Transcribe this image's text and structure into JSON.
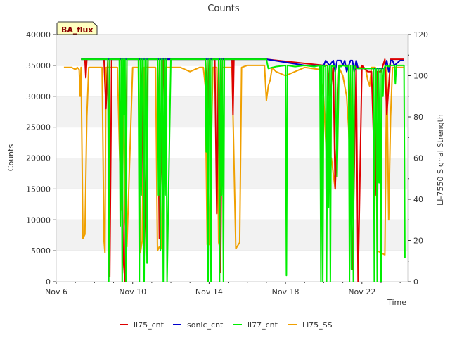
{
  "chart_data": {
    "type": "line",
    "title": "Counts",
    "site_badge": "BA_flux",
    "xlabel": "Time",
    "ylabel_left": "Counts",
    "ylabel_right": "LI-7550 Signal Strength",
    "x_range": [
      6,
      24.4
    ],
    "x_ticks": [
      6,
      10,
      14,
      18,
      22
    ],
    "x_tick_labels": [
      "Nov 6",
      "Nov 10",
      "Nov 14",
      "Nov 18",
      "Nov 22"
    ],
    "y_left_range": [
      0,
      40000
    ],
    "y_left_ticks": [
      0,
      5000,
      10000,
      15000,
      20000,
      25000,
      30000,
      35000,
      40000
    ],
    "y_right_range": [
      0,
      120
    ],
    "y_right_ticks": [
      0,
      20,
      40,
      60,
      80,
      100,
      120
    ],
    "grid": "horizontal bands",
    "legend_position": "bottom",
    "series": [
      {
        "name": "li75_cnt",
        "axis": "left",
        "color": "#dd0000",
        "x": [
          7.3,
          7.5,
          7.55,
          7.6,
          7.65,
          8.5,
          8.6,
          8.7,
          8.8,
          8.9,
          9.0,
          9.4,
          9.5,
          9.6,
          9.7,
          10.4,
          10.5,
          10.6,
          10.7,
          10.8,
          11.3,
          11.4,
          11.5,
          11.6,
          11.7,
          13.8,
          13.9,
          14.0,
          14.1,
          14.3,
          14.4,
          14.5,
          14.6,
          14.7,
          15.2,
          15.25,
          15.3,
          15.4,
          17.0,
          20.0,
          20.2,
          20.3,
          20.5,
          20.6,
          20.8,
          21.0,
          21.3,
          21.5,
          21.7,
          21.8,
          22.0,
          22.3,
          22.5,
          22.7,
          22.8,
          22.9,
          23.0,
          23.2,
          23.3,
          23.5,
          23.6,
          23.7,
          23.9,
          24.0,
          24.1,
          24.2
        ],
        "y": [
          36000,
          36000,
          33000,
          36000,
          36000,
          36000,
          28000,
          36000,
          800,
          36000,
          36000,
          36000,
          4000,
          0,
          36000,
          36000,
          28000,
          4000,
          17000,
          36000,
          36000,
          7000,
          20000,
          36000,
          36000,
          36000,
          25000,
          36000,
          36000,
          36000,
          11000,
          36000,
          1500,
          36000,
          36000,
          27000,
          36000,
          36000,
          36000,
          35000,
          35000,
          29000,
          35000,
          15000,
          35000,
          35000,
          35000,
          2000,
          35000,
          0,
          35000,
          34000,
          34000,
          14000,
          34000,
          34000,
          34000,
          36000,
          27000,
          36000,
          36000,
          36000,
          36000,
          36000,
          36000,
          36000
        ]
      },
      {
        "name": "sonic_cnt",
        "axis": "left",
        "color": "#0000cc",
        "x": [
          7.3,
          17.0,
          19.0,
          20.0,
          20.1,
          20.3,
          20.5,
          20.6,
          20.7,
          20.9,
          21.0,
          21.1,
          21.2,
          21.4,
          21.5,
          21.6,
          21.7,
          21.8,
          21.9,
          22.0,
          22.5,
          23.2,
          23.3,
          23.4,
          23.5,
          23.6,
          23.7,
          24.0,
          24.2
        ],
        "y": [
          36000,
          36000,
          35000,
          35000,
          35800,
          35000,
          35800,
          34000,
          35800,
          35800,
          35000,
          35800,
          34000,
          35800,
          35800,
          34000,
          35800,
          34500,
          34500,
          34500,
          34500,
          34500,
          35800,
          34000,
          35800,
          35800,
          35000,
          35800,
          35800
        ]
      },
      {
        "name": "li77_cnt",
        "axis": "left",
        "color": "#00ee00",
        "x": [
          7.3,
          8.7,
          8.75,
          8.8,
          8.9,
          9.2,
          9.3,
          9.35,
          9.4,
          9.45,
          9.5,
          9.55,
          9.6,
          9.65,
          9.7,
          10.0,
          10.2,
          10.3,
          10.35,
          10.4,
          10.45,
          10.5,
          10.55,
          10.6,
          10.65,
          10.7,
          10.75,
          10.8,
          11.0,
          11.3,
          11.35,
          11.4,
          11.45,
          11.5,
          11.55,
          11.6,
          11.65,
          11.7,
          11.75,
          11.8,
          12.0,
          13.8,
          13.85,
          13.9,
          13.95,
          14.0,
          14.05,
          14.1,
          14.15,
          14.2,
          14.5,
          14.55,
          14.6,
          14.65,
          14.7,
          14.75,
          14.8,
          14.9,
          17.0,
          17.1,
          17.5,
          18.0,
          18.05,
          18.1,
          18.5,
          19.0,
          19.5,
          19.8,
          19.85,
          19.9,
          19.95,
          20.0,
          20.1,
          20.15,
          20.2,
          20.25,
          20.3,
          20.35,
          20.4,
          20.5,
          20.6,
          20.7,
          20.8,
          20.9,
          21.0,
          21.2,
          21.3,
          21.35,
          21.4,
          21.45,
          21.5,
          21.55,
          21.6,
          21.7,
          21.8,
          22.0,
          22.5,
          22.6,
          22.65,
          22.7,
          22.75,
          22.8,
          22.85,
          22.9,
          22.95,
          23.0,
          23.05,
          23.1,
          23.15,
          23.2,
          23.3,
          23.4,
          23.5,
          23.6,
          23.7,
          23.75,
          23.8,
          23.9,
          24.0,
          24.2,
          24.25
        ],
        "y": [
          36000,
          36000,
          0,
          36000,
          36000,
          36000,
          36000,
          9000,
          36000,
          0,
          36000,
          27000,
          36000,
          0,
          36000,
          36000,
          36000,
          36000,
          0,
          36000,
          14000,
          36000,
          36000,
          0,
          36000,
          36000,
          3000,
          36000,
          36000,
          36000,
          14000,
          36000,
          5000,
          36000,
          36000,
          0,
          36000,
          14000,
          36000,
          0,
          36000,
          36000,
          21000,
          36000,
          0,
          36000,
          36000,
          0,
          36000,
          36000,
          36000,
          0,
          36000,
          14000,
          36000,
          0,
          36000,
          36000,
          36000,
          34500,
          34800,
          35000,
          1000,
          35000,
          34800,
          35000,
          34800,
          35000,
          0,
          35000,
          0,
          35000,
          34800,
          0,
          35000,
          12000,
          35000,
          0,
          35000,
          34800,
          35000,
          17000,
          35000,
          34800,
          35000,
          34800,
          35000,
          0,
          35000,
          2000,
          35000,
          0,
          35000,
          34500,
          34500,
          34500,
          34500,
          34500,
          0,
          34500,
          34500,
          0,
          34500,
          16000,
          34500,
          0,
          34500,
          30000,
          34500,
          34800,
          35000,
          34800,
          35000,
          35000,
          35000,
          32000,
          35000,
          35000,
          35000,
          35000,
          3800
        ]
      },
      {
        "name": "Li75_SS",
        "axis": "right",
        "color": "#f0a000",
        "x": [
          6.4,
          6.8,
          7.0,
          7.1,
          7.2,
          7.25,
          7.3,
          7.4,
          7.5,
          7.6,
          7.7,
          8.0,
          8.2,
          8.4,
          8.5,
          8.55,
          8.6,
          8.7,
          8.8,
          9.0,
          9.1,
          9.2,
          9.3,
          9.4,
          9.5,
          9.6,
          9.7,
          10.0,
          10.2,
          10.3,
          10.4,
          10.5,
          10.6,
          10.7,
          11.0,
          11.2,
          11.3,
          11.4,
          11.5,
          11.7,
          12.0,
          12.5,
          13.0,
          13.5,
          13.6,
          13.7,
          13.8,
          13.9,
          14.0,
          14.2,
          14.3,
          14.4,
          14.5,
          14.6,
          14.7,
          14.9,
          15.0,
          15.2,
          15.4,
          15.6,
          15.7,
          16.0,
          16.8,
          16.9,
          17.0,
          17.1,
          17.2,
          17.3,
          17.5,
          18.0,
          19.0,
          19.8,
          20.0,
          20.2,
          20.4,
          20.6,
          20.8,
          21.0,
          21.2,
          21.3,
          21.4,
          21.5,
          21.6,
          21.8,
          22.0,
          22.2,
          22.3,
          22.4,
          22.5,
          22.7,
          22.8,
          23.0,
          23.2,
          23.3,
          23.4,
          23.5,
          23.6,
          24.0,
          24.2
        ],
        "y": [
          104,
          104,
          103,
          104,
          103,
          90,
          104,
          21,
          23,
          80,
          104,
          104,
          104,
          104,
          20,
          14,
          104,
          104,
          104,
          104,
          104,
          104,
          67,
          35,
          104,
          30,
          17,
          104,
          104,
          104,
          14,
          20,
          104,
          104,
          104,
          104,
          15,
          17,
          16,
          104,
          104,
          104,
          102,
          104,
          104,
          104,
          95,
          18,
          18,
          104,
          104,
          104,
          19,
          15,
          104,
          104,
          104,
          104,
          16,
          19,
          104,
          105,
          105,
          105,
          88,
          95,
          98,
          104,
          102,
          100,
          104,
          103,
          89,
          50,
          60,
          45,
          104,
          100,
          90,
          75,
          50,
          104,
          104,
          104,
          104,
          103,
          98,
          95,
          104,
          104,
          15,
          14,
          13,
          104,
          30,
          80,
          104,
          104,
          104
        ]
      }
    ]
  }
}
